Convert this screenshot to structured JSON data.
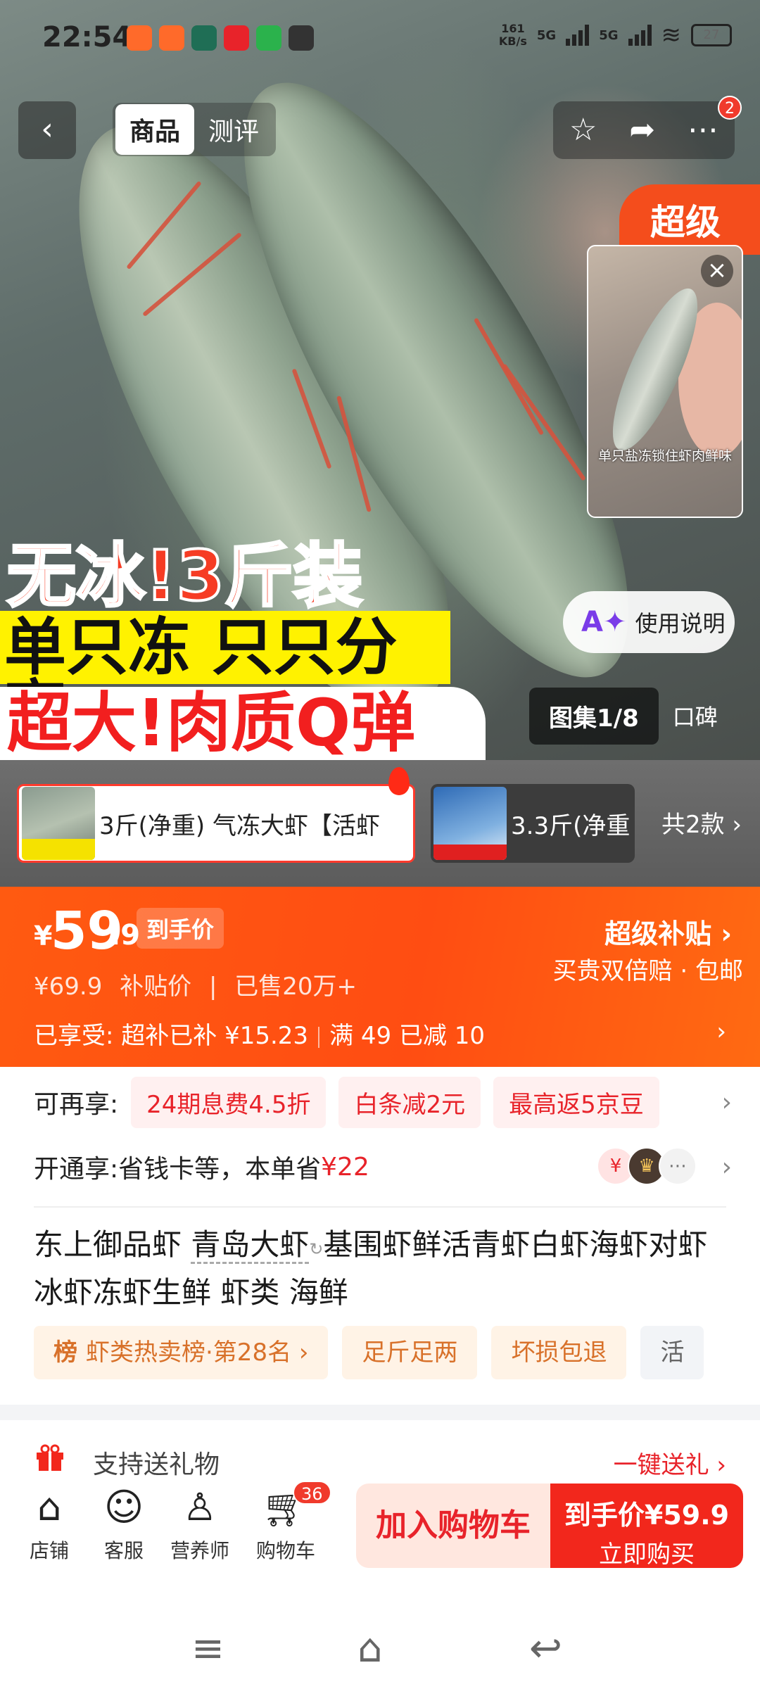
{
  "status_bar": {
    "time": "22:54",
    "net_speed_value": "161",
    "net_speed_unit": "KB/s",
    "sim1": "5G",
    "sim2": "5G",
    "battery": "27"
  },
  "nav": {
    "tabs": [
      {
        "label": "商品",
        "active": true
      },
      {
        "label": "测评",
        "active": false
      }
    ],
    "more_badge": "2"
  },
  "hero": {
    "corner_tag": "超级",
    "promo_lines": [
      "无冰!3斤装",
      "单只冻 只只分离",
      "超大!肉质Q弹"
    ],
    "video_caption": "单只盐冻锁住虾肉鲜味",
    "ai_button": "使用说明",
    "gallery_tab_active": "图集1/8",
    "gallery_tab_other": "口碑"
  },
  "variants": {
    "items": [
      {
        "label": "3斤(净重)  气冻大虾【活虾"
      },
      {
        "label": "3.3斤(净重"
      }
    ],
    "total": "共2款 ›"
  },
  "price": {
    "symbol": "¥",
    "main": "59",
    "decimal": ".9",
    "label": "到手价",
    "original": "¥69.9",
    "original_label": "补贴价",
    "sold": "已售20万+",
    "promo_title": "超级补贴 ›",
    "promo_sub": "买贵双倍赔 · 包邮",
    "enjoy_label": "已享受:",
    "enjoy_1": "超补已补 ¥15.23",
    "enjoy_2": "满 49 已减 10"
  },
  "benefits": {
    "row1_label": "可再享:",
    "row1_chips": [
      "24期息费4.5折",
      "白条减2元",
      "最高返5京豆"
    ],
    "row2_label": "开通享:",
    "row2_text": "省钱卡等，本单省",
    "row2_amount": "¥22"
  },
  "title": {
    "before": "东上御品虾 ",
    "highlight": "青岛大虾",
    "after": "基围虾鲜活青虾白虾海虾对虾冰虾冻虾生鲜 虾类 海鲜"
  },
  "tags": {
    "rank_badge": "榜",
    "rank_text": "虾类热卖榜·第28名 ›",
    "items": [
      "足斤足两",
      "坏损包退",
      "活"
    ]
  },
  "gift": {
    "text": "支持送礼物",
    "link": "一键送礼 ›"
  },
  "bottom_bar": {
    "store": "店铺",
    "service": "客服",
    "nutritionist": "营养师",
    "cart": "购物车",
    "cart_count": "36",
    "add_cart": "加入购物车",
    "buy_price": "到手价¥59.9",
    "buy_now": "立即购买"
  },
  "colors": {
    "accent": "#ff5a11",
    "red": "#e8232a",
    "buy_button": "#f2271c"
  }
}
